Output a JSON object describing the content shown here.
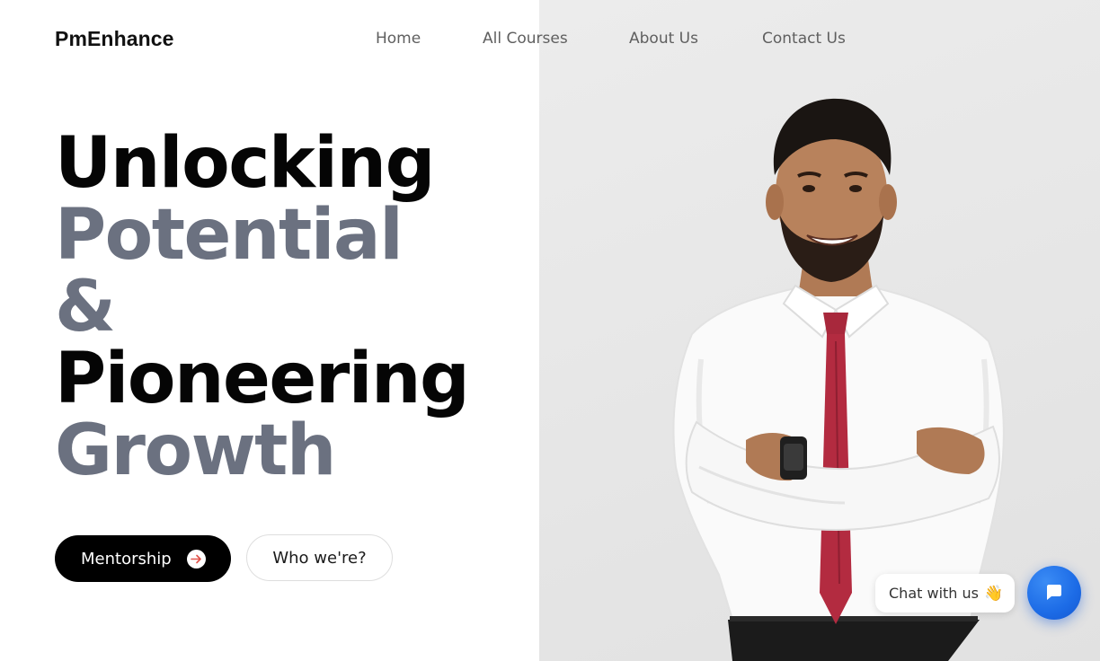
{
  "brand": {
    "name": "PmEnhance"
  },
  "nav": {
    "items": [
      {
        "label": "Home"
      },
      {
        "label": "All Courses"
      },
      {
        "label": "About Us"
      },
      {
        "label": "Contact Us"
      }
    ]
  },
  "hero": {
    "headline": {
      "line1": "Unlocking",
      "line2": "Potential",
      "line3": "&",
      "line4": "Pioneering",
      "line5": "Growth"
    },
    "primary_button": {
      "label": "Mentorship",
      "icon": "arrow-right-circle-icon"
    },
    "secondary_button": {
      "label": "Who we're?"
    }
  },
  "chat": {
    "prompt": "Chat with us",
    "emoji": "👋",
    "launcher_icon": "chat-icon"
  },
  "colors": {
    "headline_dark": "#050505",
    "headline_muted": "#6b7180",
    "primary_button_bg": "#000000",
    "chat_launcher_bg": "#1c6be6",
    "arrow_accent": "#e2534a",
    "photo_panel_bg": "#e6e6e6"
  }
}
